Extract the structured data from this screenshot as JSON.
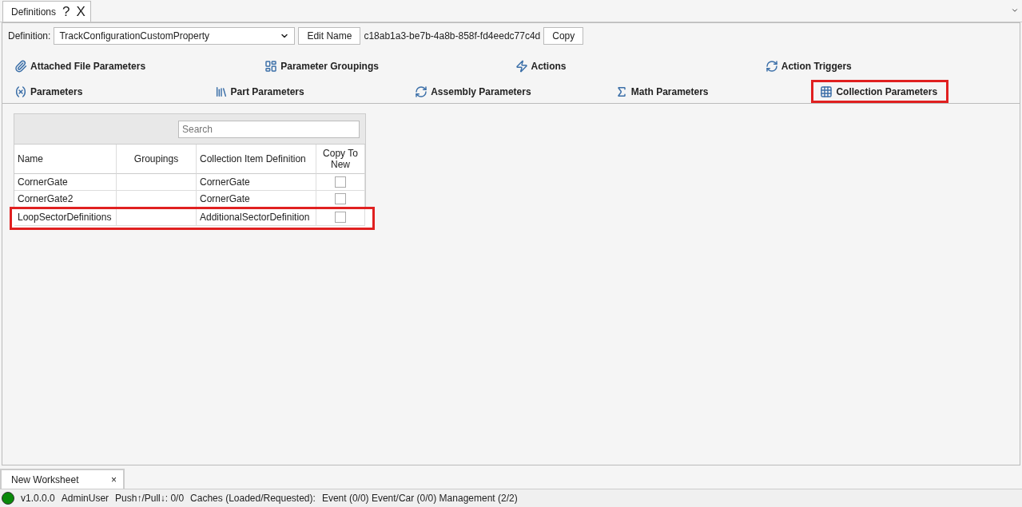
{
  "doc_tab": {
    "title": "Definitions",
    "help": "?",
    "close": "X"
  },
  "definition": {
    "label": "Definition:",
    "value": "TrackConfigurationCustomProperty",
    "edit_button": "Edit Name",
    "id": "c18ab1a3-be7b-4a8b-858f-fd4eedc77c4d",
    "copy_button": "Copy"
  },
  "tab_rows": [
    [
      {
        "label": "Attached File Parameters",
        "selected": false,
        "highlighted": false
      },
      {
        "label": "Parameter Groupings",
        "selected": false,
        "highlighted": false
      },
      {
        "label": "Actions",
        "selected": false,
        "highlighted": false
      },
      {
        "label": "Action Triggers",
        "selected": false,
        "highlighted": false
      }
    ],
    [
      {
        "label": "Parameters",
        "selected": false,
        "highlighted": false
      },
      {
        "label": "Part Parameters",
        "selected": false,
        "highlighted": false
      },
      {
        "label": "Assembly Parameters",
        "selected": false,
        "highlighted": false
      },
      {
        "label": "Math Parameters",
        "selected": false,
        "highlighted": false
      },
      {
        "label": "Collection Parameters",
        "selected": true,
        "highlighted": true
      }
    ]
  ],
  "table": {
    "search": {
      "placeholder": "Search"
    },
    "columns": [
      "Name",
      "Groupings",
      "Collection Item Definition",
      "Copy To New"
    ],
    "rows": [
      {
        "name": "CornerGate",
        "item_definition": "CornerGate",
        "copy_to_new": false,
        "highlighted": false
      },
      {
        "name": "CornerGate2",
        "item_definition": "CornerGate",
        "copy_to_new": false,
        "highlighted": false
      },
      {
        "name": "LoopSectorDefinitions",
        "item_definition": "AdditionalSectorDefinition",
        "copy_to_new": false,
        "highlighted": true
      }
    ]
  },
  "worksheet_tab": {
    "title": "New Worksheet",
    "close": "×"
  },
  "status_bar": {
    "connected": true,
    "items": [
      "v1.0.0.0",
      "AdminUser",
      "Push↑/Pull↓: 0/0",
      "Caches (Loaded/Requested):",
      "Event (0/0) Event/Car (0/0) Management (2/2)"
    ]
  }
}
